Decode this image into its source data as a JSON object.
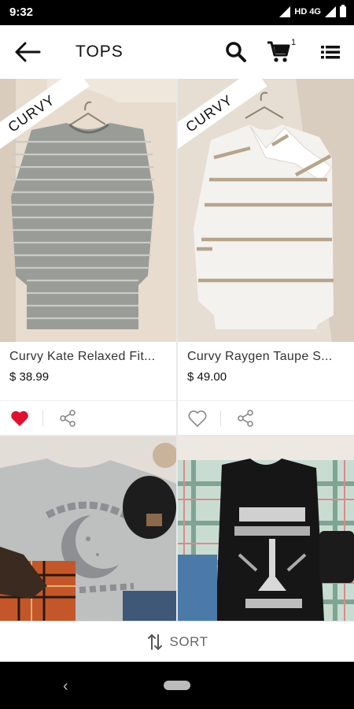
{
  "status_bar": {
    "time": "9:32",
    "network": "HD 4G"
  },
  "app_bar": {
    "title": "TOPS",
    "cart_count": "1",
    "icons": [
      "back-arrow-icon",
      "search-icon",
      "cart-icon",
      "list-icon"
    ]
  },
  "products": [
    {
      "badge": "CURVY",
      "name": "Curvy Kate Relaxed Fit...",
      "price": "$ 38.99",
      "favorited": true,
      "image": "gray striped top"
    },
    {
      "badge": "CURVY",
      "name": "Curvy Raygen Taupe S...",
      "price": "$ 49.00",
      "favorited": false,
      "image": "white taupe striped sweater"
    },
    {
      "image": "gray midnight graphic tee flatlay"
    },
    {
      "image": "plaid shirt with graphic tee flatlay"
    }
  ],
  "sort": {
    "label": "SORT"
  },
  "colors": {
    "favorite": "#e0102f",
    "status_bar": "#000000",
    "text_primary": "#111111",
    "text_secondary": "#333333"
  }
}
